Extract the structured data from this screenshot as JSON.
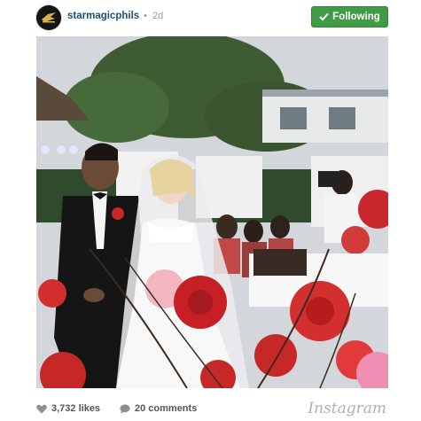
{
  "post": {
    "username": "starmagicphils",
    "separator": "•",
    "time": "2d",
    "follow_label": "Following",
    "follow_color": "#3f9b46",
    "username_color": "#1f4e79"
  },
  "photo": {
    "description_icon": "photo"
  },
  "footer": {
    "likes": "3,732 likes",
    "comments": "20 comments",
    "brand": "Instagram"
  },
  "icons": {
    "follow": "check-icon",
    "likes": "heart-icon",
    "comments": "comment-bubble-icon"
  }
}
